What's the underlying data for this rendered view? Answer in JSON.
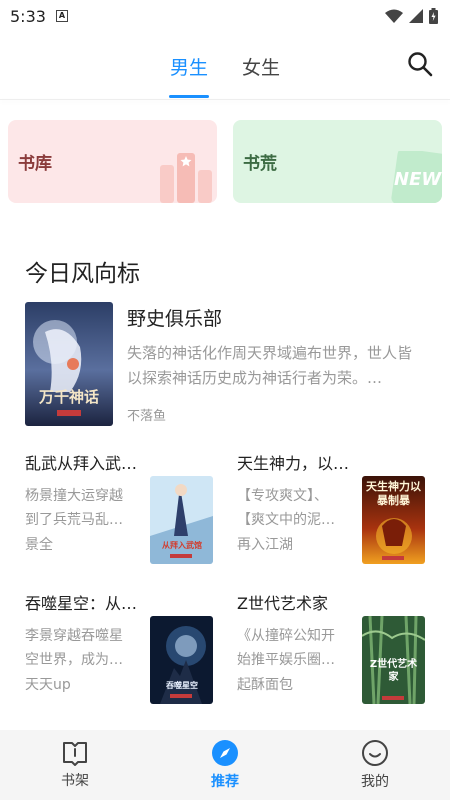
{
  "status": {
    "time": "5:33"
  },
  "tabs": [
    {
      "label": "男生",
      "active": true
    },
    {
      "label": "女生",
      "active": false
    }
  ],
  "shortcuts": [
    {
      "label": "书库"
    },
    {
      "label": "书荒",
      "badge": "NEW"
    }
  ],
  "section_title": "今日风向标",
  "featured": {
    "title": "野史俱乐部",
    "description": "失落的神话化作周天界域遍布世界，世人皆以探索神话历史成为神话行者为荣。…",
    "author": "不落鱼",
    "cover_text": "万千神话"
  },
  "books": [
    {
      "title": "乱武从拜入武…",
      "description": "杨景撞大运穿越到了兵荒马乱…",
      "author": "景全",
      "cover_text": "从拜入武馆"
    },
    {
      "title": "天生神力，以…",
      "description": "【专攻爽文】、【爽文中的泥…",
      "author": "再入江湖",
      "cover_text": "天生神力以暴制暴"
    },
    {
      "title": "吞噬星空：从…",
      "description": "李景穿越吞噬星空世界，成为…",
      "author": "天天up",
      "cover_text": "吞噬星空"
    },
    {
      "title": "Z世代艺术家",
      "description": "《从撞碎公知开始推平娱乐圈…",
      "author": "起酥面包",
      "cover_text": "Z世代艺术家"
    }
  ],
  "bottom_nav": [
    {
      "label": "书架"
    },
    {
      "label": "推荐",
      "active": true
    },
    {
      "label": "我的"
    }
  ],
  "colors": {
    "accent": "#1a90ff"
  }
}
